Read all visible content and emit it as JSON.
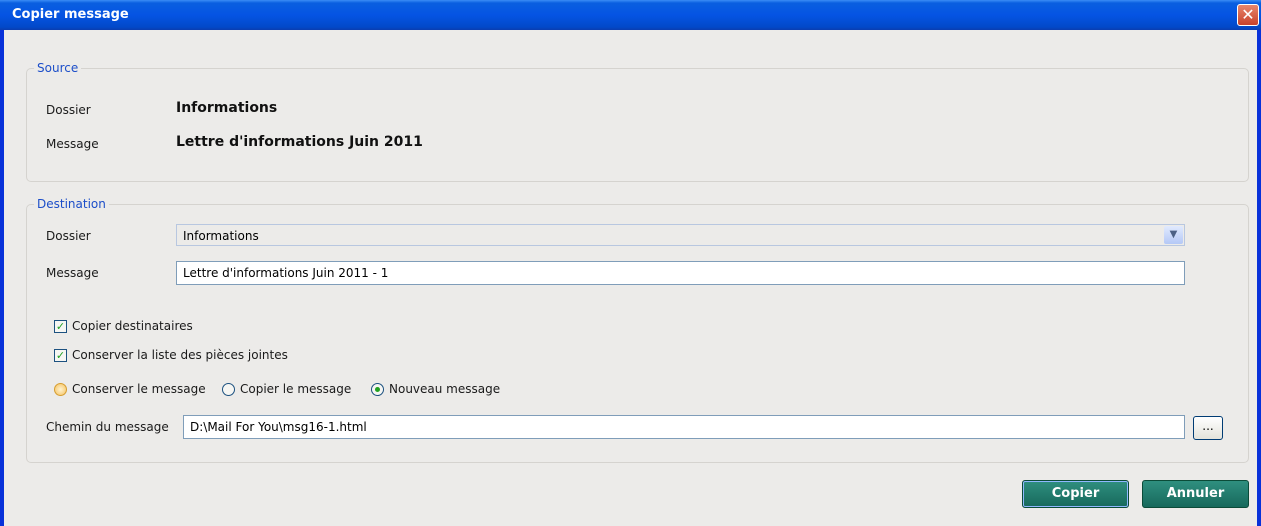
{
  "window": {
    "title": "Copier message"
  },
  "source": {
    "legend": "Source",
    "folder_label": "Dossier",
    "folder_value": "Informations",
    "message_label": "Message",
    "message_value": "Lettre d'informations Juin 2011"
  },
  "destination": {
    "legend": "Destination",
    "folder_label": "Dossier",
    "folder_selected": "Informations",
    "message_label": "Message",
    "message_value": "Lettre d'informations Juin 2011 - 1",
    "copy_recipients": {
      "label": "Copier destinataires",
      "checked": true
    },
    "keep_attachments": {
      "label": "Conserver la liste des pièces jointes",
      "checked": true
    },
    "radio_options": [
      {
        "label": "Conserver le message",
        "selected": false
      },
      {
        "label": "Copier le message",
        "selected": false
      },
      {
        "label": "Nouveau message",
        "selected": true
      }
    ],
    "path_label": "Chemin du message",
    "path_value": "D:\\Mail For You\\msg16-1.html",
    "browse_label": "..."
  },
  "buttons": {
    "copy": "Copier",
    "cancel": "Annuler"
  },
  "colors": {
    "title_bar": "#0554e3",
    "legend_text": "#1c4ec9",
    "button": "#1f7a6b"
  }
}
